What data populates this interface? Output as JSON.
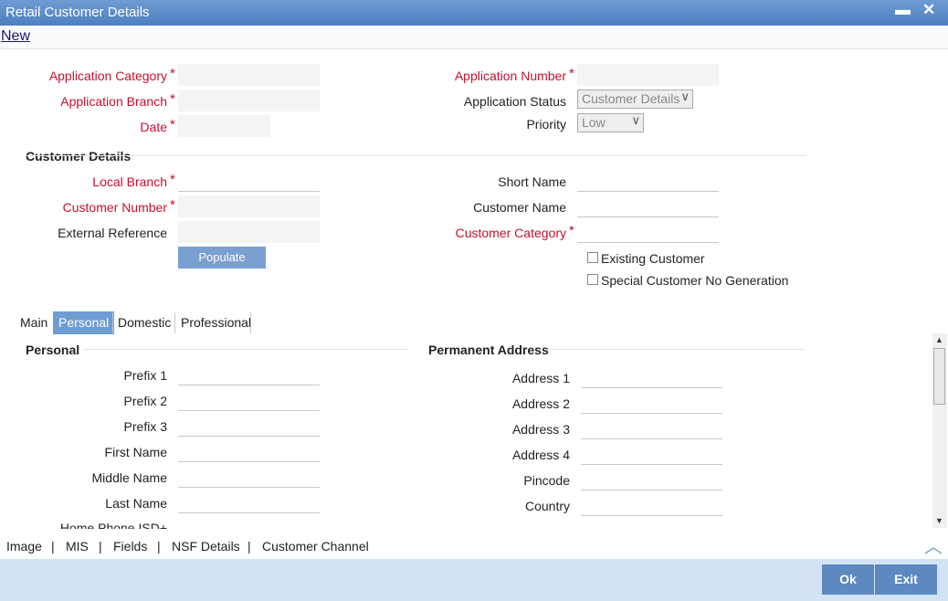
{
  "window": {
    "title": "Retail Customer Details",
    "minimize": "▬",
    "close": "✕"
  },
  "toolbar": {
    "new_label": "New"
  },
  "header": {
    "application_category": "Application Category",
    "application_branch": "Application Branch",
    "date": "Date",
    "application_number": "Application Number",
    "application_status": "Application Status",
    "application_status_value": "Customer Details",
    "priority": "Priority",
    "priority_value": "Low",
    "required_mark": "*"
  },
  "customer_details": {
    "section_title": "Customer Details",
    "local_branch": "Local Branch",
    "customer_number": "Customer Number",
    "external_reference": "External Reference",
    "short_name": "Short Name",
    "customer_name": "Customer Name",
    "customer_category": "Customer Category",
    "populate_label": "Populate",
    "existing_customer": "Existing Customer",
    "special_customer_no_generation": "Special Customer No Generation"
  },
  "tabs": [
    {
      "label": "Main"
    },
    {
      "label": "Personal"
    },
    {
      "label": "Domestic"
    },
    {
      "label": "Professional"
    }
  ],
  "personal": {
    "section_title": "Personal",
    "prefix1": "Prefix 1",
    "prefix2": "Prefix 2",
    "prefix3": "Prefix 3",
    "first_name": "First Name",
    "middle_name": "Middle Name",
    "last_name": "Last Name",
    "home_phone_isd": "Home Phone ISD+"
  },
  "permanent_address": {
    "section_title": "Permanent Address",
    "address1": "Address 1",
    "address2": "Address 2",
    "address3": "Address 3",
    "address4": "Address 4",
    "pincode": "Pincode",
    "country": "Country"
  },
  "bottom_links": [
    "Image",
    "MIS",
    "Fields",
    "NSF Details",
    "Customer Channel"
  ],
  "bottom_separator": "|",
  "footer": {
    "ok_label": "Ok",
    "exit_label": "Exit"
  },
  "colors": {
    "titlebar": "#5a89c7",
    "active_tab": "#6f9cd3",
    "required": "#c8102e",
    "footer": "#d3e3f6"
  }
}
